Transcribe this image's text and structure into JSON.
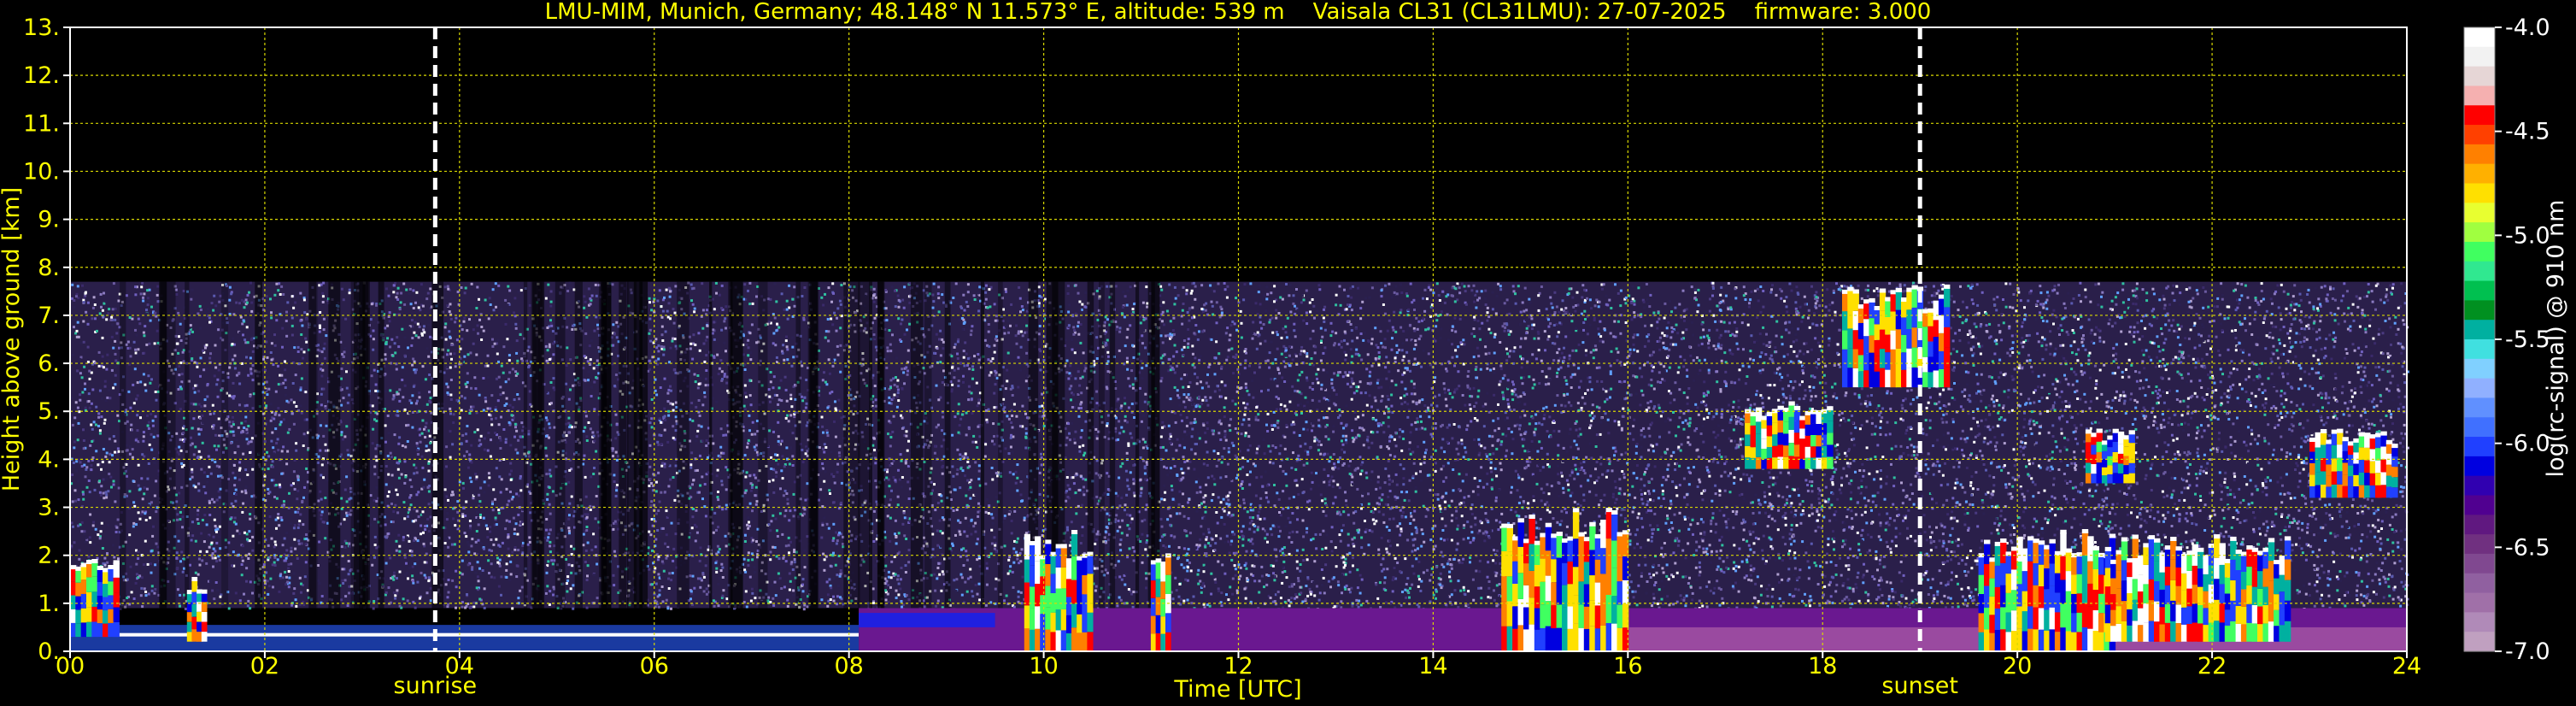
{
  "chart_data": {
    "type": "heatmap",
    "title": "LMU-MIM, Munich, Germany; 48.148° N 11.573° E, altitude: 539 m    Vaisala CL31 (CL31LMU): 27-07-2025    firmware: 3.000",
    "xlabel": "Time [UTC]",
    "ylabel": "Height above ground [km]",
    "xlim": [
      0,
      24
    ],
    "ylim": [
      0,
      13
    ],
    "x_ticks": [
      "00",
      "02",
      "04",
      "06",
      "08",
      "10",
      "12",
      "14",
      "16",
      "18",
      "20",
      "22",
      "24"
    ],
    "y_ticks": [
      "0.",
      "1.",
      "2.",
      "3.",
      "4.",
      "5.",
      "6.",
      "7.",
      "8.",
      "9.",
      "10.",
      "11.",
      "12.",
      "13."
    ],
    "grid": true,
    "markers": [
      {
        "label": "sunrise",
        "time": 3.75
      },
      {
        "label": "sunset",
        "time": 19.0
      }
    ],
    "colorbar": {
      "label": "log(rc-signal) @ 910 nm",
      "range": [
        -7.0,
        -4.0
      ],
      "ticks": [
        "-4.0",
        "-4.5",
        "-5.0",
        "-5.5",
        "-6.0",
        "-6.5",
        "-7.0"
      ],
      "colors": [
        "#ffffff",
        "#f2f2f2",
        "#e6d6d6",
        "#f5b0b0",
        "#ff0000",
        "#ff4000",
        "#ff8000",
        "#ffb000",
        "#ffe000",
        "#e8ff30",
        "#a0ff40",
        "#40ff60",
        "#30e890",
        "#00c050",
        "#009020",
        "#00b0a0",
        "#40e0e0",
        "#80d0ff",
        "#90b0ff",
        "#6090ff",
        "#4070ff",
        "#2040ff",
        "#0000e0",
        "#3000b0",
        "#500090",
        "#601880",
        "#703080",
        "#804890",
        "#9060a0",
        "#a070a8",
        "#b08ab8",
        "#c0a0c0"
      ]
    },
    "data_coverage_top_km": 7.7,
    "features": [
      {
        "name": "boundary-layer-aerosol",
        "t_start": 0,
        "t_end": 24,
        "h_top_km": 0.5
      },
      {
        "name": "noise-region",
        "t_start": 0,
        "t_end": 24,
        "h_bottom_km": 1.0,
        "h_top_km": 7.7
      },
      {
        "name": "low-cloud",
        "t_start": 0.0,
        "t_end": 0.5,
        "h_bottom_km": 0.3,
        "h_top_km": 2.1
      },
      {
        "name": "low-cloud",
        "t_start": 1.2,
        "t_end": 1.4,
        "h_bottom_km": 0.2,
        "h_top_km": 1.5
      },
      {
        "name": "convective-cloud",
        "t_start": 9.8,
        "t_end": 10.5,
        "h_bottom_km": 0.0,
        "h_top_km": 2.5
      },
      {
        "name": "convective-cloud",
        "t_start": 11.1,
        "t_end": 11.3,
        "h_bottom_km": 0.0,
        "h_top_km": 2.0
      },
      {
        "name": "convective-cloud",
        "t_start": 14.7,
        "t_end": 16.0,
        "h_bottom_km": 0.0,
        "h_top_km": 3.0
      },
      {
        "name": "mid-level-cloud",
        "t_start": 17.2,
        "t_end": 18.1,
        "h_bottom_km": 3.8,
        "h_top_km": 5.2
      },
      {
        "name": "mid-level-cloud",
        "t_start": 18.2,
        "t_end": 19.3,
        "h_bottom_km": 5.5,
        "h_top_km": 7.6
      },
      {
        "name": "convective-cloud",
        "t_start": 19.6,
        "t_end": 21.0,
        "h_bottom_km": 0.0,
        "h_top_km": 2.5
      },
      {
        "name": "stratocumulus",
        "t_start": 20.9,
        "t_end": 22.8,
        "h_bottom_km": 0.2,
        "h_top_km": 2.4
      },
      {
        "name": "mid-level-cloud",
        "t_start": 20.7,
        "t_end": 21.2,
        "h_bottom_km": 3.5,
        "h_top_km": 4.6
      },
      {
        "name": "mid-level-cloud",
        "t_start": 23.0,
        "t_end": 23.9,
        "h_bottom_km": 3.2,
        "h_top_km": 4.6
      }
    ]
  }
}
